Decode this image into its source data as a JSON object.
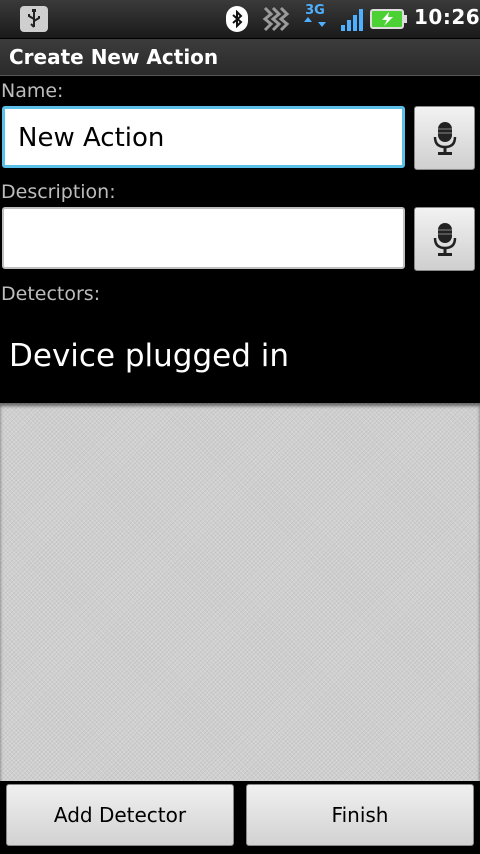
{
  "status_bar": {
    "time": "10:26",
    "network_type": "3G",
    "icons": [
      "usb-icon",
      "bluetooth-icon",
      "data-activity-icon",
      "3g-icon",
      "signal-icon",
      "battery-charging-icon"
    ]
  },
  "title_bar": {
    "title": "Create New Action"
  },
  "form": {
    "name_label": "Name:",
    "name_value": "New Action",
    "description_label": "Description:",
    "description_value": "",
    "detectors_label": "Detectors:"
  },
  "detectors": [
    "Device plugged in"
  ],
  "buttons": {
    "add_detector": "Add Detector",
    "finish": "Finish"
  },
  "colors": {
    "focus_border": "#5ac0e8",
    "network_blue": "#4fb0ff",
    "battery_green": "#4cd135"
  }
}
